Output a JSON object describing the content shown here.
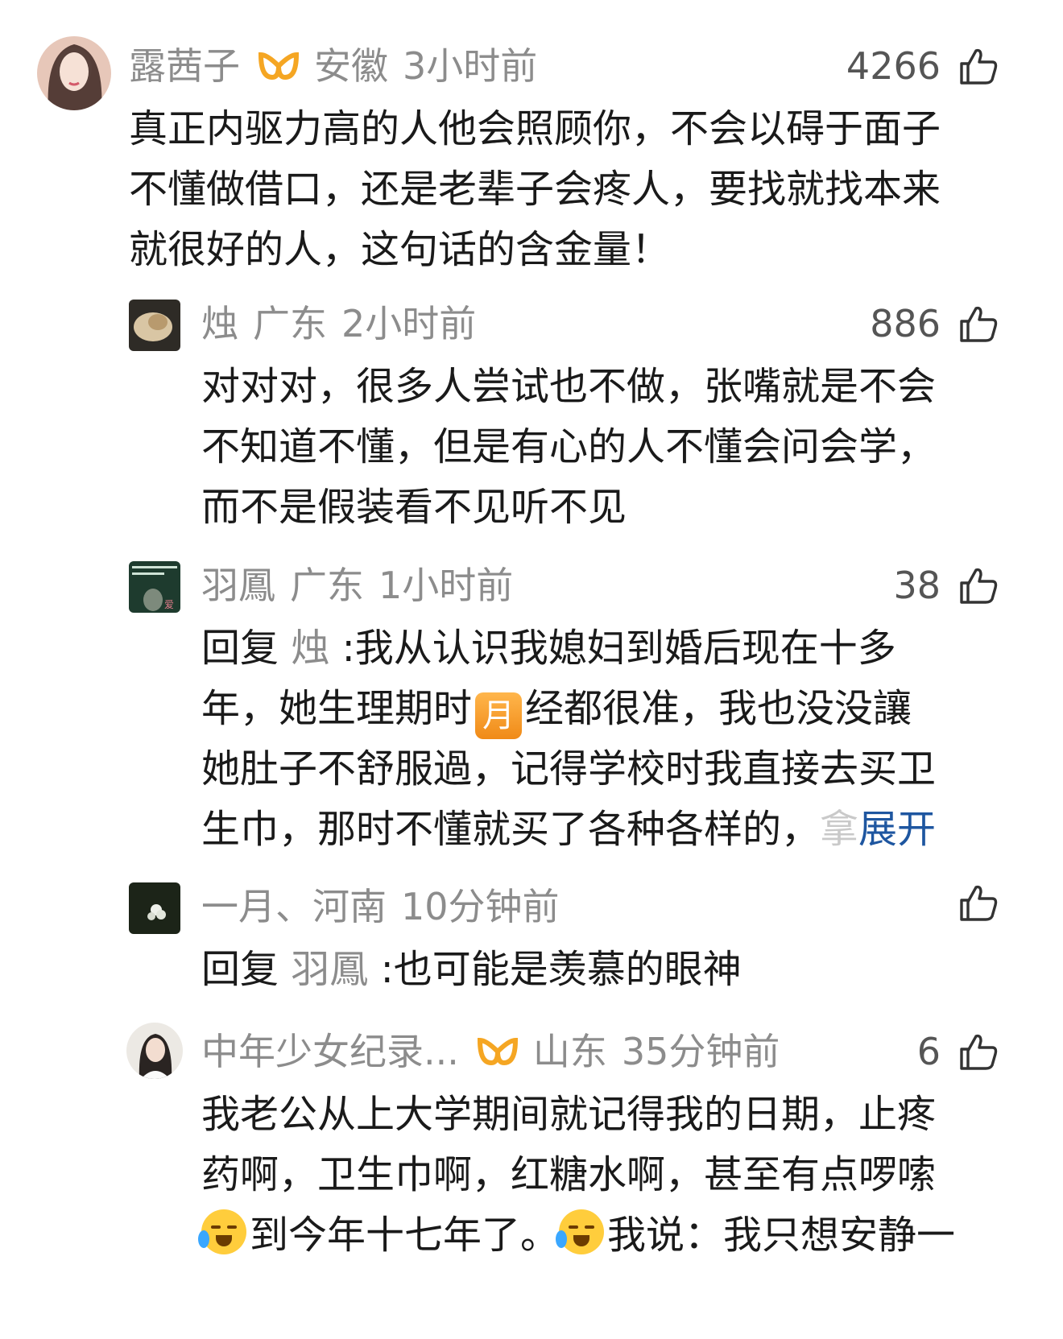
{
  "comments": [
    {
      "name": "露茜子",
      "location": "安徽",
      "time": "3小时前",
      "likes": "4266",
      "lines": [
        "真正内驱力高的人他会照顾你，不会以碍于面子",
        "不懂做借口，还是老辈子会疼人，要找就找本来",
        "就很好的人，这句话的含金量！"
      ]
    },
    {
      "name": "烛",
      "location": "广东",
      "time": "2小时前",
      "likes": "886",
      "lines": [
        "对对对，很多人尝试也不做，张嘴就是不会",
        "不知道不懂，但是有心的人不懂会问会学，",
        "而不是假装看不见听不见"
      ]
    },
    {
      "name": "羽鳳",
      "location": "广东",
      "time": "1小时前",
      "likes": "38",
      "reply_prefix": "回复",
      "reply_to": "烛",
      "line1_rest": ":我从认识我媳妇到婚后现在十多",
      "line2_a": "年，她生理期时",
      "moon_char": "月",
      "line2_b": "经都很准，我也没没讓",
      "line3": "她肚子不舒服過，记得学校时我直接去买卫",
      "line4_a": "生巾，那时不懂就买了各种各样的，",
      "line4_fade": "拿",
      "expand": "展开"
    },
    {
      "name": "一月、",
      "location": "河南",
      "time": "10分钟前",
      "reply_prefix": "回复",
      "reply_to": "羽鳳",
      "line1_rest": ":也可能是羡慕的眼神"
    },
    {
      "name": "中年少女纪录...",
      "location": "山东",
      "time": "35分钟前",
      "likes": "6",
      "line1": "我老公从上大学期间就记得我的日期，止疼",
      "line2": "药啊，卫生巾啊，红糖水啊，甚至有点啰嗦",
      "line3_a": "到今年十七年了。",
      "line3_b": "我说：我只想安静一"
    }
  ],
  "colors": {
    "meta": "#8c8c8c",
    "text": "#1a1a1a",
    "expand": "#1e56a0",
    "vip": "#f5a623"
  },
  "icons": [
    "thumbs-up-icon",
    "vip-badge-icon",
    "crying-face-emoji",
    "moon-emoji"
  ]
}
